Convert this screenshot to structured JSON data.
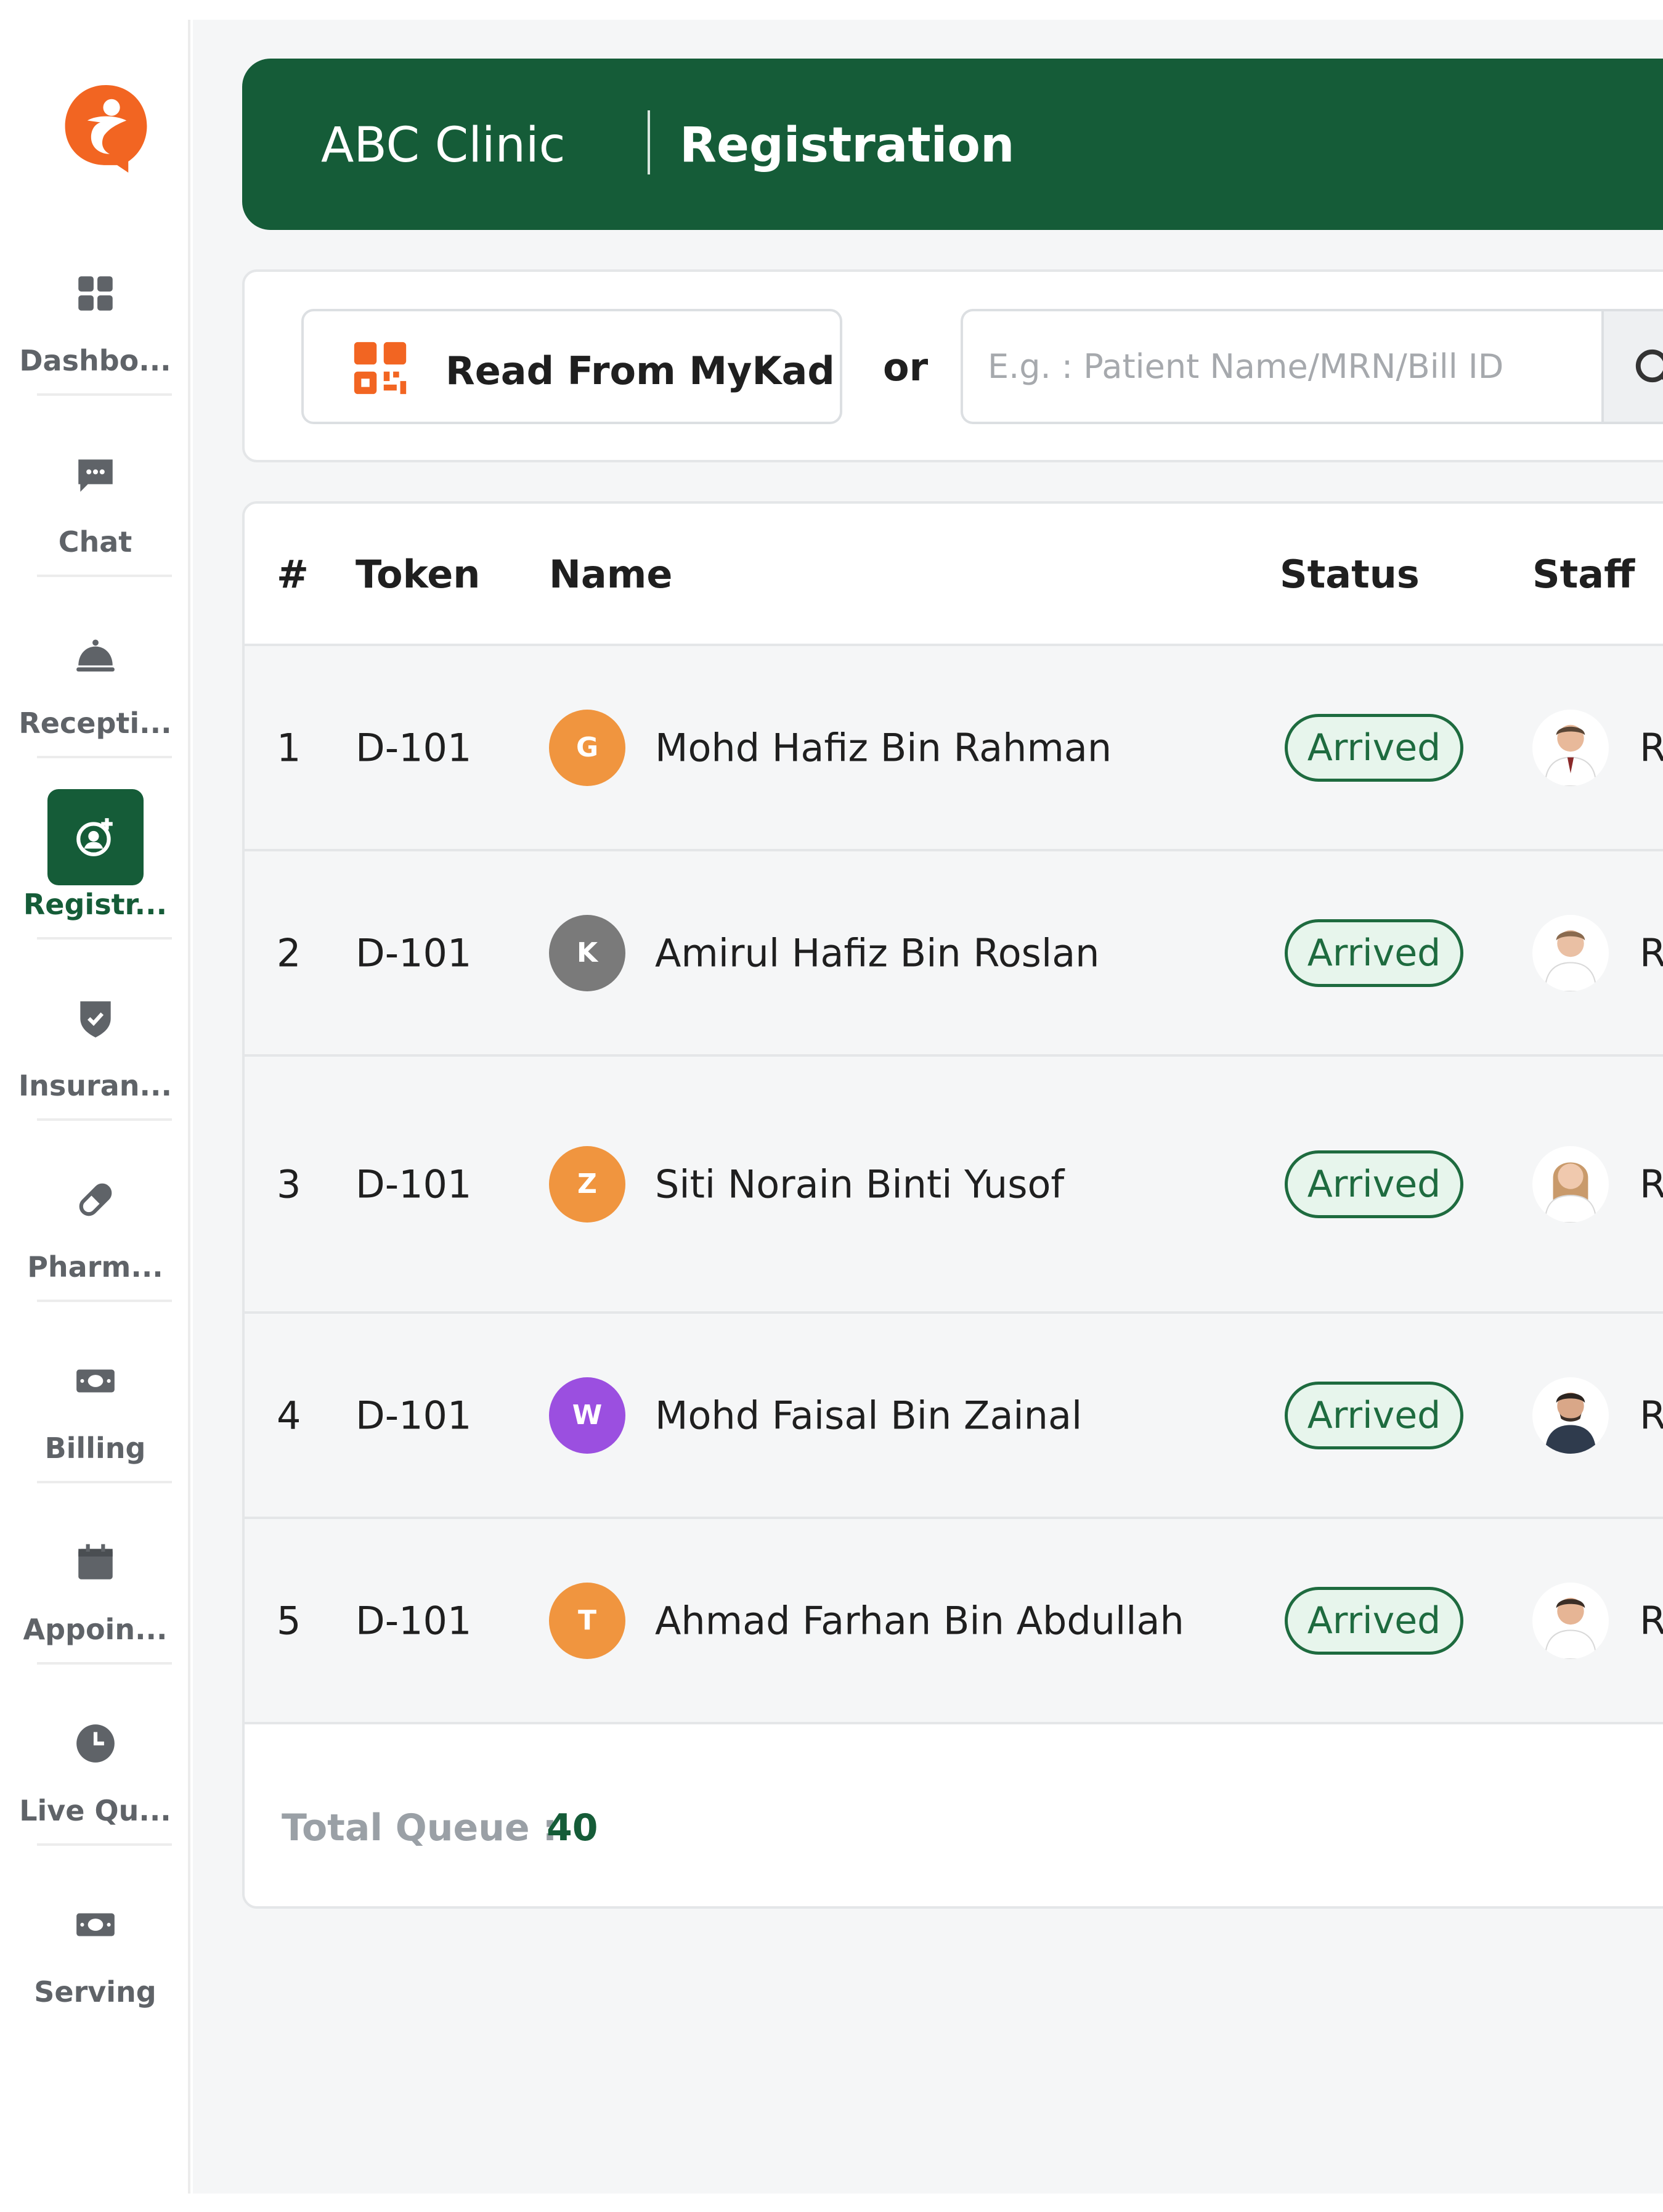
{
  "sidebar": {
    "items": [
      {
        "label": "Dashbo...",
        "icon": "grid-icon",
        "active": false
      },
      {
        "label": "Chat",
        "icon": "chat-icon",
        "active": false
      },
      {
        "label": "Recepti...",
        "icon": "bell-icon",
        "active": false
      },
      {
        "label": "Registr...",
        "icon": "user-add-icon",
        "active": true
      },
      {
        "label": "Insuran...",
        "icon": "shield-icon",
        "active": false
      },
      {
        "label": "Pharm...",
        "icon": "pill-icon",
        "active": false
      },
      {
        "label": "Billing",
        "icon": "money-icon",
        "active": false
      },
      {
        "label": "Appoin...",
        "icon": "calendar-icon",
        "active": false
      },
      {
        "label": "Live Qu...",
        "icon": "clock-icon",
        "active": false
      },
      {
        "label": "Serving",
        "icon": "money-icon",
        "active": false
      }
    ]
  },
  "header": {
    "clinic": "ABC Clinic",
    "page": "Registration"
  },
  "search": {
    "mykad_label": "Read From MyKad",
    "or_label": "or",
    "placeholder": "E.g. : Patient Name/MRN/Bill ID"
  },
  "table": {
    "headers": {
      "num": "#",
      "token": "Token",
      "name": "Name",
      "status": "Status",
      "staff": "Staff"
    },
    "rows": [
      {
        "num": "1",
        "token": "D-101",
        "initial": "G",
        "avatar_color": "#f0953f",
        "name": "Mohd Hafiz Bin Rahman",
        "status": "Arrived",
        "staff_partial": "Re"
      },
      {
        "num": "2",
        "token": "D-101",
        "initial": "K",
        "avatar_color": "#7a7a7a",
        "name": "Amirul Hafiz Bin Roslan",
        "status": "Arrived",
        "staff_partial": "Re"
      },
      {
        "num": "3",
        "token": "D-101",
        "initial": "Z",
        "avatar_color": "#f0953f",
        "name": "Siti Norain Binti Yusof",
        "status": "Arrived",
        "staff_partial": "Re"
      },
      {
        "num": "4",
        "token": "D-101",
        "initial": "W",
        "avatar_color": "#9b4fe0",
        "name": "Mohd Faisal Bin Zainal",
        "status": "Arrived",
        "staff_partial": "Re"
      },
      {
        "num": "5",
        "token": "D-101",
        "initial": "T",
        "avatar_color": "#f0953f",
        "name": "Ahmad Farhan Bin Abdullah",
        "status": "Arrived",
        "staff_partial": "Re"
      }
    ],
    "total_label": "Total Queue :",
    "total_value": "40"
  },
  "colors": {
    "primary": "#155c38",
    "accent_orange": "#f26522",
    "status_green": "#1e6b3f"
  }
}
